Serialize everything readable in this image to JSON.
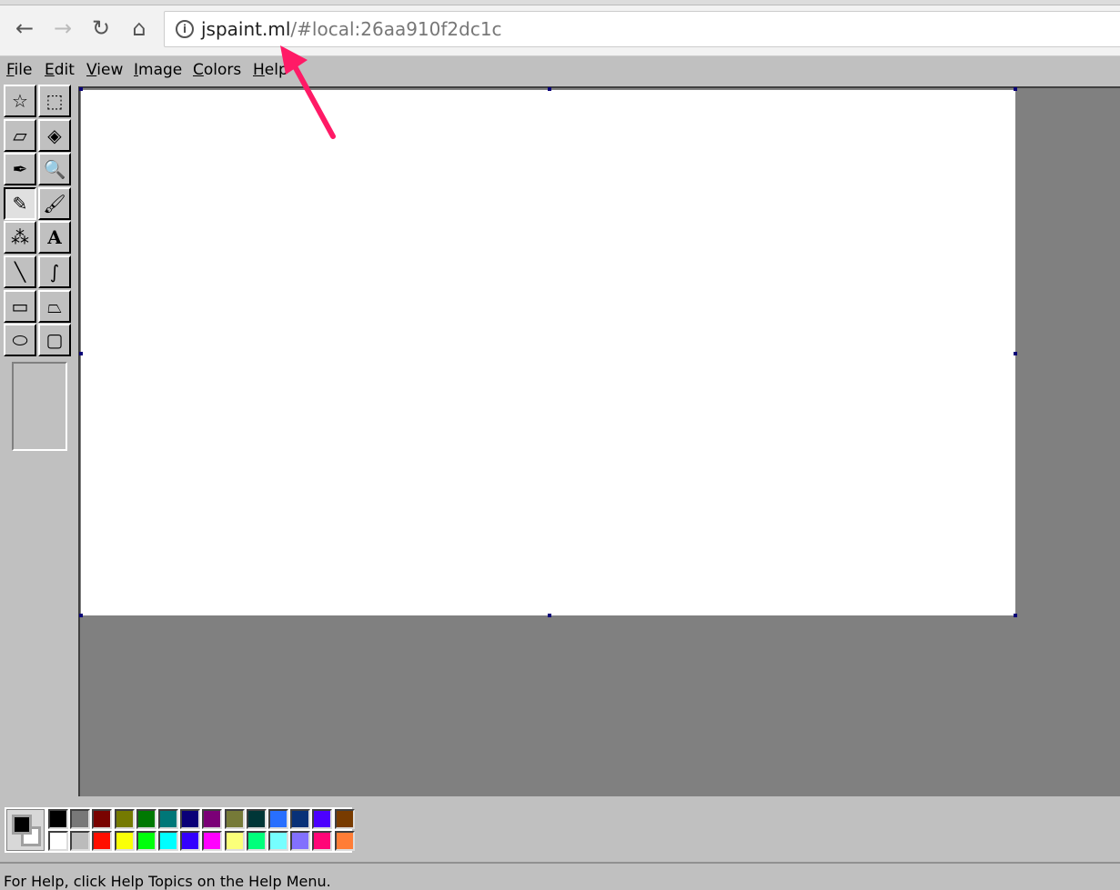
{
  "browser": {
    "url_host": "jspaint.ml",
    "url_rest": "/#local:26aa910f2dc1c"
  },
  "menu": [
    {
      "label": "File",
      "key": "F",
      "rest": "ile"
    },
    {
      "label": "Edit",
      "key": "E",
      "rest": "dit"
    },
    {
      "label": "View",
      "key": "V",
      "rest": "iew"
    },
    {
      "label": "Image",
      "key": "I",
      "rest": "mage"
    },
    {
      "label": "Colors",
      "key": "C",
      "rest": "olors"
    },
    {
      "label": "Help",
      "key": "H",
      "rest": "elp"
    }
  ],
  "tools": [
    {
      "name": "free-form-select",
      "glyph": "☆"
    },
    {
      "name": "select",
      "glyph": "⬚"
    },
    {
      "name": "eraser",
      "glyph": "▱"
    },
    {
      "name": "fill-with-color",
      "glyph": "◈"
    },
    {
      "name": "pick-color",
      "glyph": "✒"
    },
    {
      "name": "magnifier",
      "glyph": "🔍"
    },
    {
      "name": "pencil",
      "glyph": "✎",
      "selected": true
    },
    {
      "name": "brush",
      "glyph": "🖌"
    },
    {
      "name": "airbrush",
      "glyph": "⁂"
    },
    {
      "name": "text",
      "glyph": "A"
    },
    {
      "name": "line",
      "glyph": "╲"
    },
    {
      "name": "curve",
      "glyph": "∫"
    },
    {
      "name": "rectangle",
      "glyph": "▭"
    },
    {
      "name": "polygon",
      "glyph": "⏢"
    },
    {
      "name": "ellipse",
      "glyph": "⬭"
    },
    {
      "name": "rounded-rectangle",
      "glyph": "▢"
    }
  ],
  "colors": {
    "foreground": "#000000",
    "background": "#ffffff",
    "accent_arrow": "#ff1a66"
  },
  "palette": {
    "row1": [
      "#000000",
      "#787878",
      "#790300",
      "#757a01",
      "#007902",
      "#007778",
      "#0a0078",
      "#7b0077",
      "#767a38",
      "#003637",
      "#286ffe",
      "#083178",
      "#4c00fe",
      "#783b00"
    ],
    "row2": [
      "#ffffff",
      "#bbbbbb",
      "#ff0e00",
      "#faff08",
      "#00ff0b",
      "#00feff",
      "#3400fe",
      "#ff00fe",
      "#fbff7a",
      "#00ff7b",
      "#76feff",
      "#8270fe",
      "#ff0677",
      "#ff7d36"
    ]
  },
  "status": "For Help, click Help Topics on the Help Menu."
}
